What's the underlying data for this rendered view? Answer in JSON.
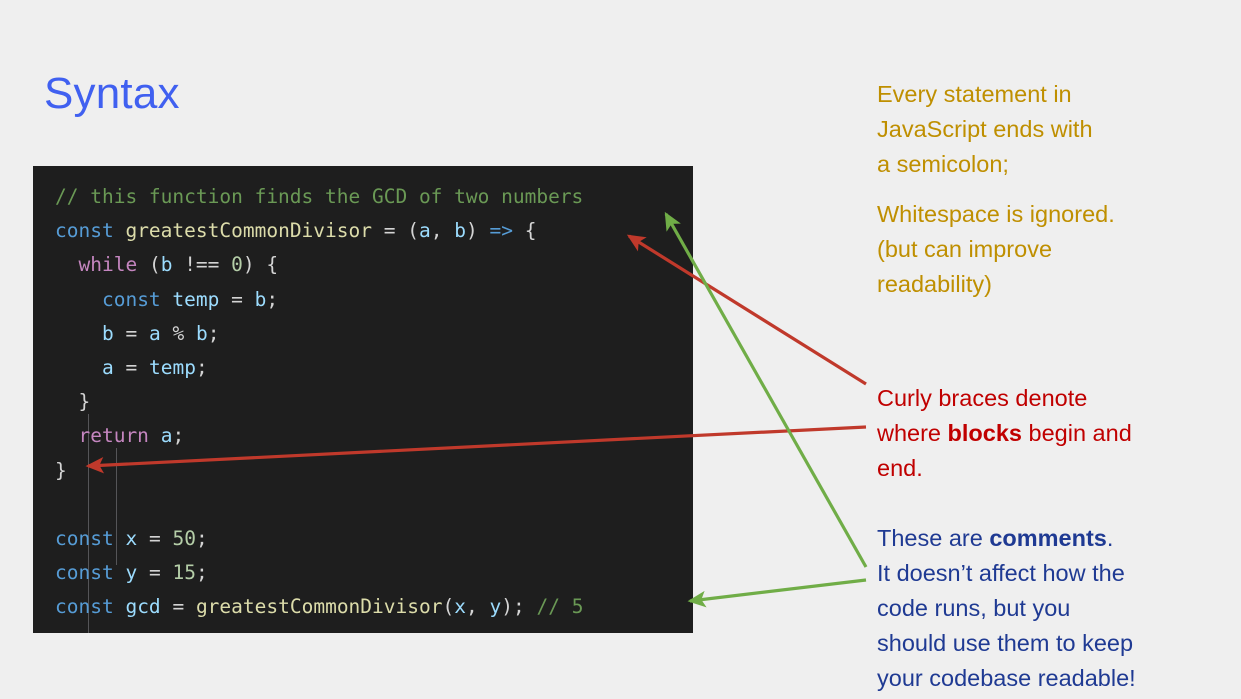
{
  "slide": {
    "title": "Syntax",
    "background_color": "#efefef",
    "title_color": "#4060f0"
  },
  "code_block": {
    "background_color": "#1e1e1e",
    "language": "javascript",
    "lines": [
      {
        "id": "line-1",
        "text": "// this function finds the GCD of two numbers"
      },
      {
        "id": "line-2",
        "text": "const greatestCommonDivisor = (a, b) => {"
      },
      {
        "id": "line-3",
        "text": "  while (b !== 0) {"
      },
      {
        "id": "line-4",
        "text": "    const temp = b;"
      },
      {
        "id": "line-5",
        "text": "    b = a % b;"
      },
      {
        "id": "line-6",
        "text": "    a = temp;"
      },
      {
        "id": "line-7",
        "text": "  }"
      },
      {
        "id": "line-8",
        "text": "  return a;"
      },
      {
        "id": "line-9",
        "text": "}"
      },
      {
        "id": "line-10",
        "text": ""
      },
      {
        "id": "line-11",
        "text": "const x = 50;"
      },
      {
        "id": "line-12",
        "text": "const y = 15;"
      },
      {
        "id": "line-13",
        "text": "const gcd = greatestCommonDivisor(x, y); // 5"
      }
    ],
    "token_colors": {
      "comment": "#6a9955",
      "keyword": "#569cd6",
      "control": "#c586c0",
      "function": "#dcdcaa",
      "variable": "#9cdcfe",
      "number": "#b5cea8",
      "punctuation": "#d4d4d4"
    }
  },
  "annotations": {
    "semicolon": {
      "color": "#bf8f00",
      "lines": [
        "Every statement in",
        "JavaScript ends with",
        "a semicolon;"
      ]
    },
    "whitespace": {
      "color": "#bf8f00",
      "lines": [
        "Whitespace is ignored.",
        "(but can improve",
        "readability)"
      ]
    },
    "braces": {
      "color": "#c00000",
      "line1": "Curly braces denote",
      "line2_pre": "where ",
      "line2_bold": "blocks",
      "line2_post": " begin and",
      "line3": "end."
    },
    "comments": {
      "color": "#1f3a93",
      "line1_pre": "These are ",
      "line1_bold": "comments",
      "line1_post": ".",
      "line2": "It doesn’t affect how the",
      "line3": "code runs, but you",
      "line4": "should use them to keep",
      "line5": "your codebase readable!"
    }
  },
  "arrows": [
    {
      "name": "arrow-braces-open",
      "color": "#c0392b",
      "points_to": "opening-curly-brace-line-2"
    },
    {
      "name": "arrow-braces-close",
      "color": "#c0392b",
      "points_to": "closing-curly-brace-line-9"
    },
    {
      "name": "arrow-comment-top",
      "color": "#70ad47",
      "points_to": "comment-line-1"
    },
    {
      "name": "arrow-comment-inline",
      "color": "#70ad47",
      "points_to": "inline-comment-line-13"
    }
  ]
}
